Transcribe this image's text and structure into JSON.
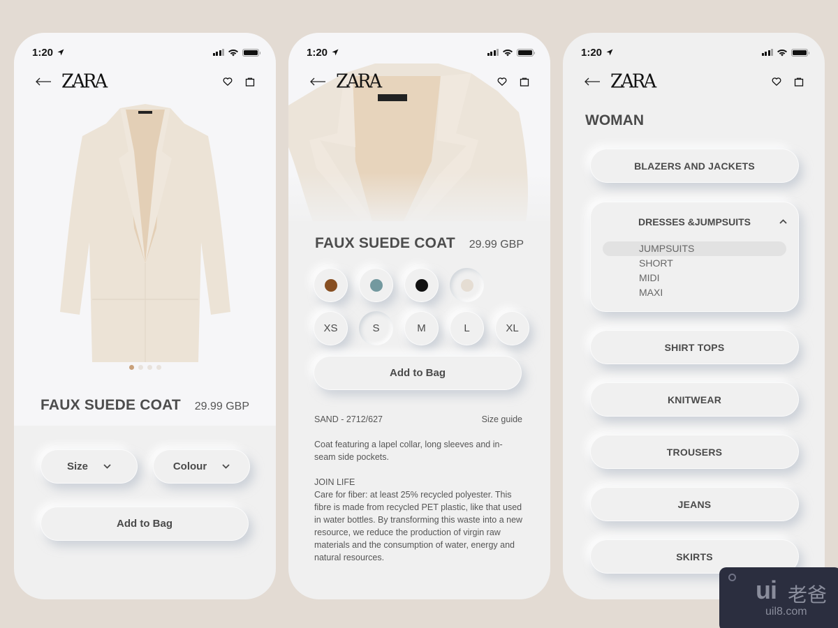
{
  "status_bar": {
    "time": "1:20"
  },
  "brand": {
    "logo": "ZARA"
  },
  "colors": {
    "background": "#e3dbd3",
    "surface": "#f0f0f0",
    "text": "#4a4a4a",
    "active_dot": "#c8a07a"
  },
  "product": {
    "title": "FAUX SUEDE COAT",
    "price": "29.99 GBP",
    "carousel": {
      "count": 4,
      "active_index": 0
    }
  },
  "screen1": {
    "size_select_label": "Size",
    "colour_select_label": "Colour",
    "add_to_bag": "Add to Bag"
  },
  "screen2": {
    "colours": [
      {
        "name": "brown",
        "hex": "#874f22"
      },
      {
        "name": "blue-grey",
        "hex": "#73999f"
      },
      {
        "name": "black",
        "hex": "#111111"
      },
      {
        "name": "sand",
        "hex": "#e5ddd3",
        "selected": true
      }
    ],
    "sizes": [
      {
        "label": "XS"
      },
      {
        "label": "S",
        "selected": true
      },
      {
        "label": "M"
      },
      {
        "label": "L"
      },
      {
        "label": "XL"
      }
    ],
    "add_to_bag": "Add to Bag",
    "sku": "SAND - 2712/627",
    "size_guide": "Size guide",
    "description": "Coat featuring a lapel collar, long sleeves and in-seam side pockets.",
    "join_life_title": "JOIN LIFE",
    "join_life_text": "Care for fiber: at least 25% recycled polyester. This fibre is made from recycled PET plastic, like that used in water bottles. By transforming this waste into a new resource, we reduce the production of virgin raw materials and the consumption of water, energy and natural resources."
  },
  "screen3": {
    "section_title": "WOMAN",
    "categories": [
      {
        "label": "BLAZERS AND JACKETS"
      },
      {
        "label": "DRESSES &JUMPSUITS",
        "expanded": true,
        "subitems": [
          {
            "label": "JUMPSUITS",
            "active": true
          },
          {
            "label": "SHORT"
          },
          {
            "label": "MIDI"
          },
          {
            "label": "MAXI"
          }
        ]
      },
      {
        "label": "SHIRT TOPS"
      },
      {
        "label": "KNITWEAR"
      },
      {
        "label": "TROUSERS"
      },
      {
        "label": "JEANS"
      },
      {
        "label": "SKIRTS"
      }
    ]
  },
  "watermark": {
    "logo": "ui",
    "cn": "老爸",
    "url": "uil8.com"
  }
}
